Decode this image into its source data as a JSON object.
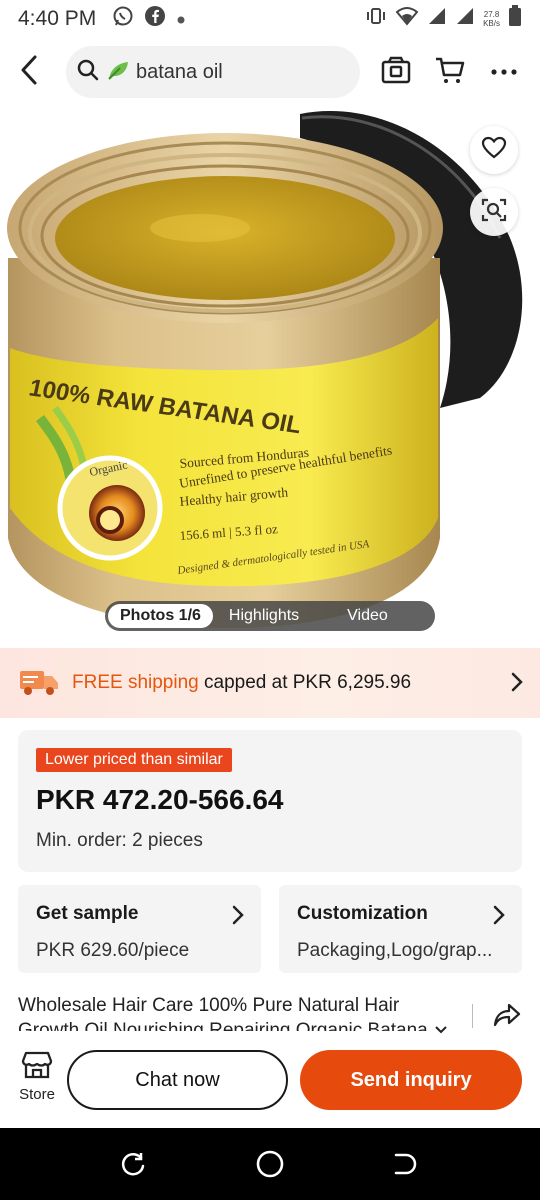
{
  "status_bar": {
    "time": "4:40 PM",
    "net_speed_value": "27.8",
    "net_speed_unit": "KB/s"
  },
  "header": {
    "search_text": "batana oil",
    "icons": [
      "back-arrow-icon",
      "search-icon",
      "leaf-icon",
      "camera-search-icon",
      "cart-icon",
      "more-icon"
    ]
  },
  "product_image": {
    "jar_label": {
      "headline": "100% RAW BATANA OIL",
      "badge": "Organic",
      "line1": "Sourced from Honduras",
      "line2": "Unrefined to preserve healthful benefits",
      "line3": "Healthy hair growth",
      "volume": "156.6 ml | 5.3 fl oz",
      "footer": "Designed & dermatologically tested in USA"
    },
    "media_tabs": [
      {
        "label": "Photos 1/6",
        "active": true
      },
      {
        "label": "Highlights",
        "active": false
      },
      {
        "label": "Video",
        "active": false
      }
    ]
  },
  "shipping": {
    "free": "FREE shipping",
    "rest": " capped at PKR 6,295.96"
  },
  "price_card": {
    "tag": "Lower priced than similar",
    "price": "PKR 472.20-566.64",
    "min_order": "Min. order: 2 pieces"
  },
  "options": [
    {
      "title": "Get sample",
      "value": "PKR 629.60/piece"
    },
    {
      "title": "Customization",
      "value": "Packaging,Logo/grap..."
    }
  ],
  "product_title": "Wholesale Hair Care 100% Pure Natural Hair Growth Oil Nourishing Repairing Organic Batana",
  "actions": {
    "store": "Store",
    "chat": "Chat now",
    "send": "Send inquiry"
  },
  "colors": {
    "accent": "#e64a0d",
    "tag_bg": "#e9461e",
    "ship_bg": "#fde6df",
    "card_bg": "#f4f4f4"
  }
}
